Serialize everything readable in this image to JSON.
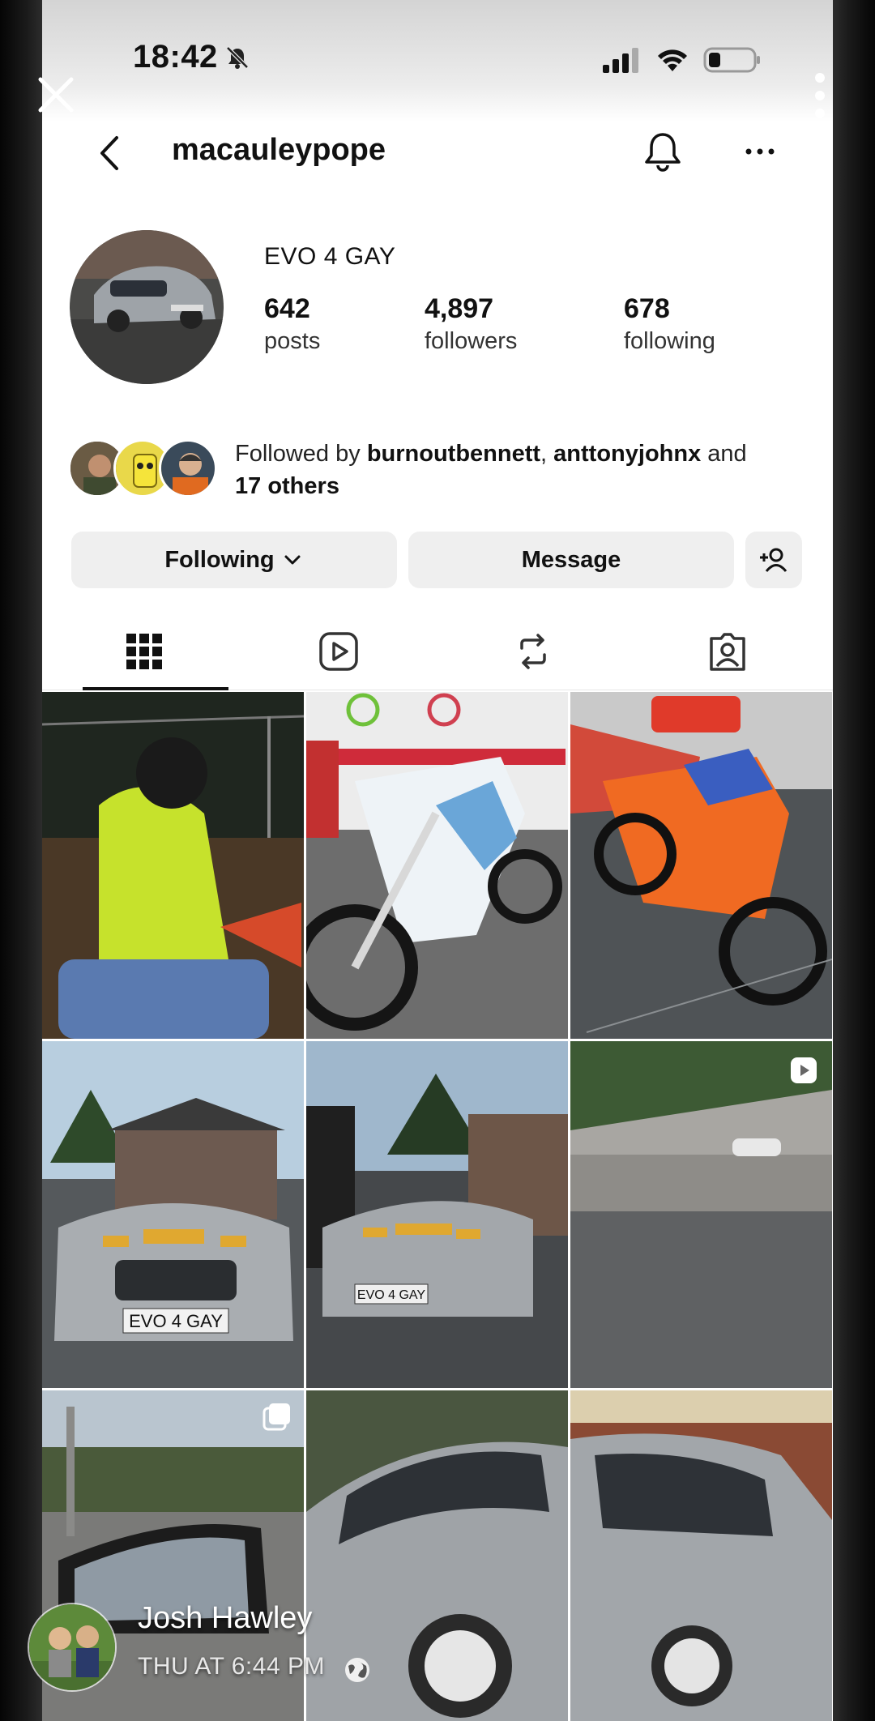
{
  "status_bar": {
    "time": "18:42"
  },
  "profile": {
    "username": "macauleypope",
    "bio_name": "EVO 4 GAY",
    "stats": [
      {
        "value": "642",
        "label": "posts"
      },
      {
        "value": "4,897",
        "label": "followers"
      },
      {
        "value": "678",
        "label": "following"
      }
    ],
    "followed_by": {
      "prefix": "Followed by ",
      "user1": "burnoutbennett",
      "sep": ", ",
      "user2": "anttonyjohnx",
      "and": " and",
      "others": "17 others"
    },
    "buttons": {
      "following": "Following",
      "message": "Message"
    }
  },
  "tabs": [
    "grid-icon",
    "reels-icon",
    "reposts-icon",
    "tagged-icon"
  ],
  "grid_posts": [
    "Rider in yellow motocross gear",
    "White and blue dirt bike by van",
    "Orange dirt bike in showroom",
    "Silver Subaru front view",
    "Silver Subaru three-quarter view",
    "Road wall reel",
    "Car mirror view",
    "Silver Subaru with white wheels",
    "Silver Subaru side view"
  ],
  "story": {
    "owner_name": "Josh Hawley",
    "timestamp": "THU AT 6:44 PM"
  },
  "colors": {
    "text": "#111111",
    "button_bg": "#efefef",
    "white": "#ffffff"
  }
}
